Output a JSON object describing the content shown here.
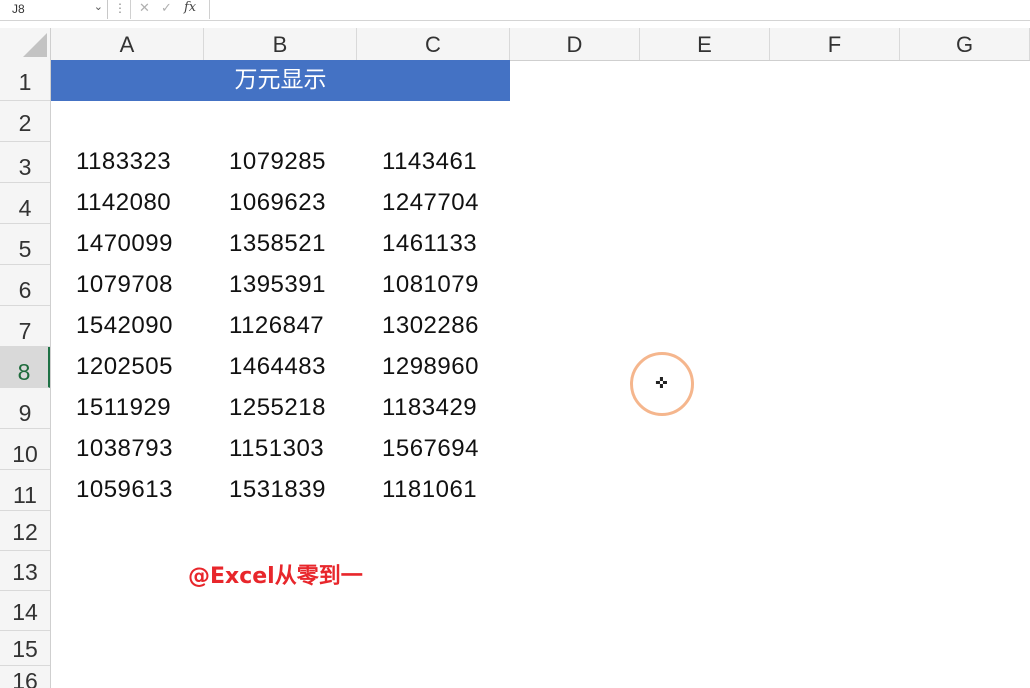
{
  "formula_bar": {
    "name_box": "J8",
    "dots": "⋮",
    "cancel": "✕",
    "confirm": "✓",
    "fx": "fx"
  },
  "columns": [
    "A",
    "B",
    "C",
    "D",
    "E",
    "F",
    "G"
  ],
  "rows": [
    "1",
    "2",
    "3",
    "4",
    "5",
    "6",
    "7",
    "8",
    "9",
    "10",
    "11",
    "12",
    "13",
    "14",
    "15",
    "16"
  ],
  "selected_row": "8",
  "sheet": {
    "title": "万元显示",
    "data": [
      [
        "1183323",
        "1079285",
        "1143461"
      ],
      [
        "1142080",
        "1069623",
        "1247704"
      ],
      [
        "1470099",
        "1358521",
        "1461133"
      ],
      [
        "1079708",
        "1395391",
        "1081079"
      ],
      [
        "1542090",
        "1126847",
        "1302286"
      ],
      [
        "1202505",
        "1464483",
        "1298960"
      ],
      [
        "1511929",
        "1255218",
        "1183429"
      ],
      [
        "1038793",
        "1151303",
        "1567694"
      ],
      [
        "1059613",
        "1531839",
        "1181061"
      ]
    ],
    "watermark": "@Excel从零到一"
  },
  "colors": {
    "title_fill": "#4472c4",
    "watermark": "#e8262b",
    "cursor_ring": "#f5b68d"
  }
}
